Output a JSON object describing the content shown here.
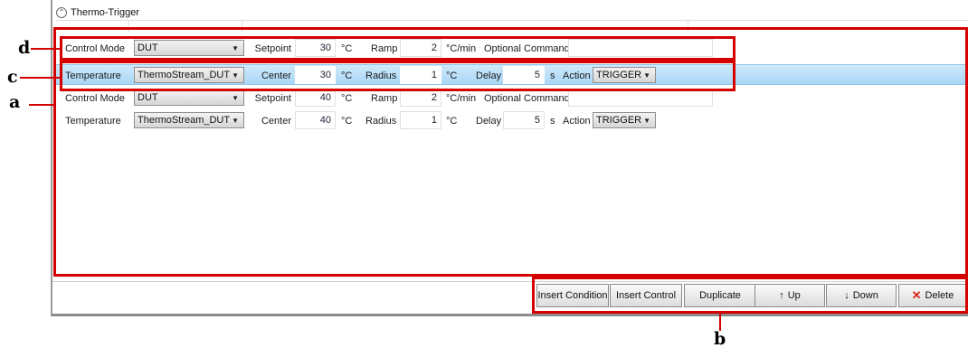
{
  "panel": {
    "title": "Thermo-Trigger"
  },
  "rows": [
    {
      "col1": "Control Mode",
      "dropdown": "DUT",
      "col3": "Setpoint",
      "val1": "30",
      "unit1": "°C",
      "col5": "Ramp",
      "val2": "2",
      "unit2": "°C/min",
      "col7": "Optional Command"
    },
    {
      "col1": "Temperature",
      "dropdown": "ThermoStream_DUT",
      "col3": "Center",
      "val1": "30",
      "unit1": "°C",
      "col5": "Radius",
      "val2": "1",
      "unit2": "°C",
      "col7": "Delay",
      "val3": "5",
      "unit3": "s",
      "col9": "Action",
      "action": "TRIGGER"
    },
    {
      "col1": "Control Mode",
      "dropdown": "DUT",
      "col3": "Setpoint",
      "val1": "40",
      "unit1": "°C",
      "col5": "Ramp",
      "val2": "2",
      "unit2": "°C/min",
      "col7": "Optional Command"
    },
    {
      "col1": "Temperature",
      "dropdown": "ThermoStream_DUT",
      "col3": "Center",
      "val1": "40",
      "unit1": "°C",
      "col5": "Radius",
      "val2": "1",
      "unit2": "°C",
      "col7": "Delay",
      "val3": "5",
      "unit3": "s",
      "col9": "Action",
      "action": "TRIGGER"
    }
  ],
  "toolbar": {
    "insert_condition": "Insert Condition",
    "insert_control": "Insert Control",
    "duplicate": "Duplicate",
    "up": "Up",
    "down": "Down",
    "delete": "Delete",
    "up_arrow": "↑",
    "down_arrow": "↓",
    "delete_x": "✕"
  },
  "annotations": {
    "a": "a",
    "b": "b",
    "c": "c",
    "d": "d"
  },
  "icons": {
    "collapse": "chevron-up-icon",
    "dropdown": "caret-down-icon",
    "up": "arrow-up-icon",
    "down": "arrow-down-icon",
    "delete": "x-icon"
  },
  "colors": {
    "highlight_box": "#d40000",
    "selected_row": "#a9d7f6",
    "delete_icon": "#d9261c"
  }
}
